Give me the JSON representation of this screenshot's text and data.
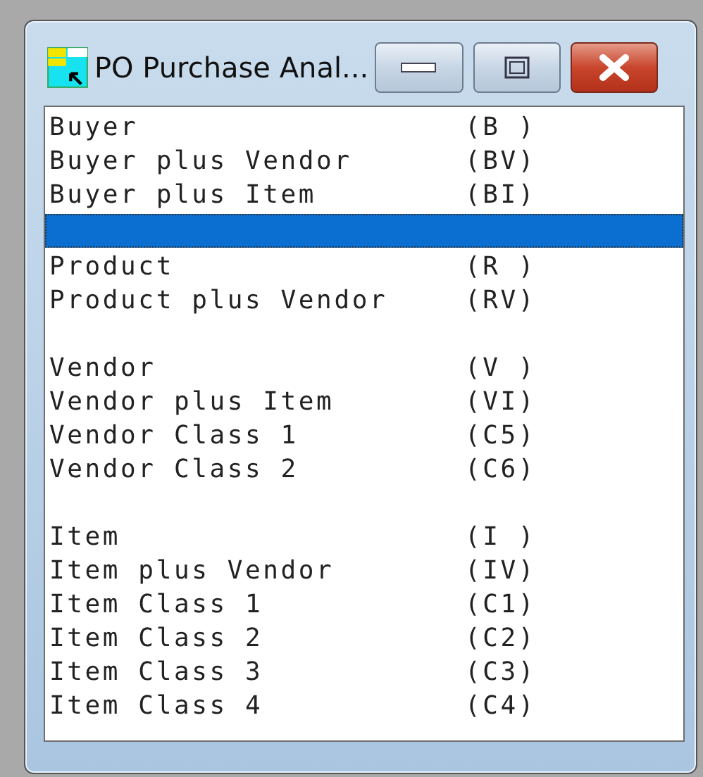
{
  "window": {
    "title": "PO Purchase Anal..."
  },
  "rows": [
    {
      "kind": "item",
      "label": "Buyer",
      "code": "(B )",
      "selected": false
    },
    {
      "kind": "item",
      "label": "Buyer plus Vendor",
      "code": "(BV)",
      "selected": false
    },
    {
      "kind": "item",
      "label": "Buyer plus Item",
      "code": "(BI)",
      "selected": false
    },
    {
      "kind": "blank",
      "selected": true
    },
    {
      "kind": "item",
      "label": "Product",
      "code": "(R )",
      "selected": false
    },
    {
      "kind": "item",
      "label": "Product plus Vendor",
      "code": "(RV)",
      "selected": false
    },
    {
      "kind": "blank"
    },
    {
      "kind": "item",
      "label": "Vendor",
      "code": "(V )",
      "selected": false
    },
    {
      "kind": "item",
      "label": "Vendor plus Item",
      "code": "(VI)",
      "selected": false
    },
    {
      "kind": "item",
      "label": "Vendor Class 1",
      "code": "(C5)",
      "selected": false
    },
    {
      "kind": "item",
      "label": "Vendor Class 2",
      "code": "(C6)",
      "selected": false
    },
    {
      "kind": "blank"
    },
    {
      "kind": "item",
      "label": "Item",
      "code": "(I )",
      "selected": false
    },
    {
      "kind": "item",
      "label": "Item plus Vendor",
      "code": "(IV)",
      "selected": false
    },
    {
      "kind": "item",
      "label": "Item Class 1",
      "code": "(C1)",
      "selected": false
    },
    {
      "kind": "item",
      "label": "Item Class 2",
      "code": "(C2)",
      "selected": false
    },
    {
      "kind": "item",
      "label": "Item Class 3",
      "code": "(C3)",
      "selected": false
    },
    {
      "kind": "item",
      "label": "Item Class 4",
      "code": "(C4)",
      "selected": false
    }
  ]
}
